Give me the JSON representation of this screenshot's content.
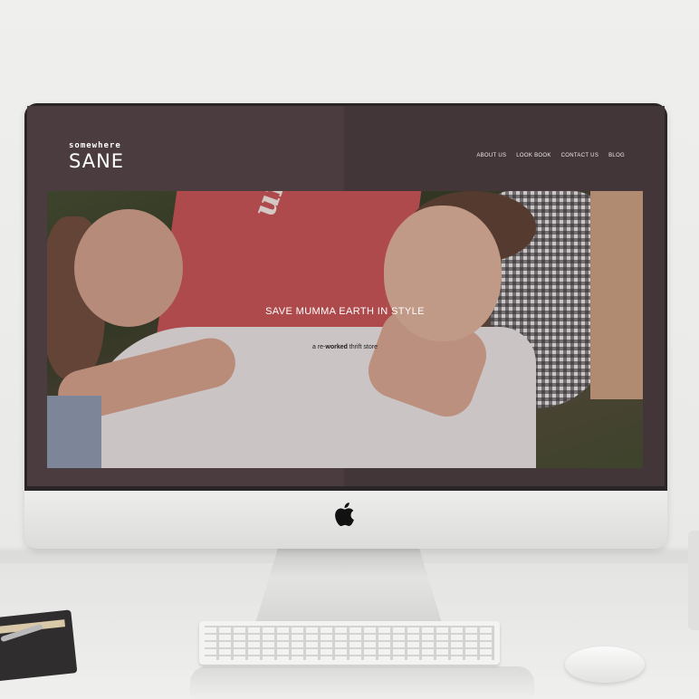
{
  "site": {
    "logo_top": "somewhere",
    "logo_main": "SANE",
    "nav": [
      {
        "label": "ABOUT US"
      },
      {
        "label": "LOOK BOOK"
      },
      {
        "label": "CONTACT US"
      },
      {
        "label": "BLOG"
      }
    ],
    "hero": {
      "shirt_text": "unloval",
      "title": "SAVE MUMMA EARTH IN STYLE",
      "subtitle_prefix": "a re-",
      "subtitle_bold": "worked",
      "subtitle_suffix": " thrift store"
    }
  },
  "colors": {
    "accent_red": "#c95253",
    "screen_bg": "#4a3c3f"
  },
  "icons": {
    "apple": "apple-logo-icon"
  }
}
